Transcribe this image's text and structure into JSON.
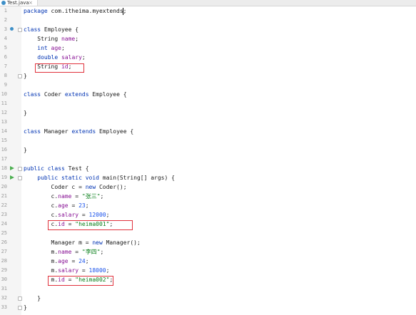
{
  "tab": {
    "filename": "Test.java",
    "close_glyph": "×"
  },
  "lines": [
    {
      "n": "1",
      "code": "<span class=\"kw\">package</span> com.itheima.myextends;"
    },
    {
      "n": "2",
      "code": ""
    },
    {
      "n": "3",
      "code": "<span class=\"kw\">class</span> Employee {"
    },
    {
      "n": "4",
      "code": "    String <span class=\"fld\">name</span>;"
    },
    {
      "n": "5",
      "code": "    <span class=\"kw\">int</span> <span class=\"fld\">age</span>;"
    },
    {
      "n": "6",
      "code": "    <span class=\"kw\">double</span> <span class=\"fld\">salary</span>;"
    },
    {
      "n": "7",
      "code": "    String <span class=\"fld\">id</span>;"
    },
    {
      "n": "8",
      "code": "}"
    },
    {
      "n": "9",
      "code": ""
    },
    {
      "n": "10",
      "code": "<span class=\"kw\">class</span> Coder <span class=\"kw\">extends</span> Employee {"
    },
    {
      "n": "11",
      "code": ""
    },
    {
      "n": "12",
      "code": "}"
    },
    {
      "n": "13",
      "code": ""
    },
    {
      "n": "14",
      "code": "<span class=\"kw\">class</span> Manager <span class=\"kw\">extends</span> Employee {"
    },
    {
      "n": "15",
      "code": ""
    },
    {
      "n": "16",
      "code": "}"
    },
    {
      "n": "17",
      "code": ""
    },
    {
      "n": "18",
      "code": "<span class=\"kw\">public class</span> Test {"
    },
    {
      "n": "19",
      "code": "    <span class=\"kw\">public static void</span> main(String[] args) {"
    },
    {
      "n": "20",
      "code": "        Coder c = <span class=\"kw\">new</span> Coder();"
    },
    {
      "n": "21",
      "code": "        c.<span class=\"fld\">name</span> = <span class=\"str\">\"张三\"</span>;"
    },
    {
      "n": "22",
      "code": "        c.<span class=\"fld\">age</span> = <span class=\"num\">23</span>;"
    },
    {
      "n": "23",
      "code": "        c.<span class=\"fld\">salary</span> = <span class=\"num\">12000</span>;"
    },
    {
      "n": "24",
      "code": "        c.<span class=\"fld\">id</span> = <span class=\"str\">\"heima001\"</span>;"
    },
    {
      "n": "25",
      "code": ""
    },
    {
      "n": "26",
      "code": "        Manager m = <span class=\"kw\">new</span> Manager();"
    },
    {
      "n": "27",
      "code": "        m.<span class=\"fld\">name</span> = <span class=\"str\">\"李四\"</span>;"
    },
    {
      "n": "28",
      "code": "        m.<span class=\"fld\">age</span> = <span class=\"num\">24</span>;"
    },
    {
      "n": "29",
      "code": "        m.<span class=\"fld\">salary</span> = <span class=\"num\">18000</span>;"
    },
    {
      "n": "30",
      "code": "        m.<span class=\"fld\">id</span> = <span class=\"str\">\"heima002\"</span>;"
    },
    {
      "n": "31",
      "code": ""
    },
    {
      "n": "32",
      "code": "    }"
    },
    {
      "n": "33",
      "code": "}"
    }
  ],
  "colors": {
    "keyword": "#0033b3",
    "field": "#871094",
    "string": "#067d17",
    "number": "#1750eb",
    "highlight_box": "#e0313c",
    "run_icon": "#4caf50"
  },
  "gutter_icons": {
    "3": "implemented-icon",
    "18": "run-icon",
    "19": "run-icon"
  }
}
